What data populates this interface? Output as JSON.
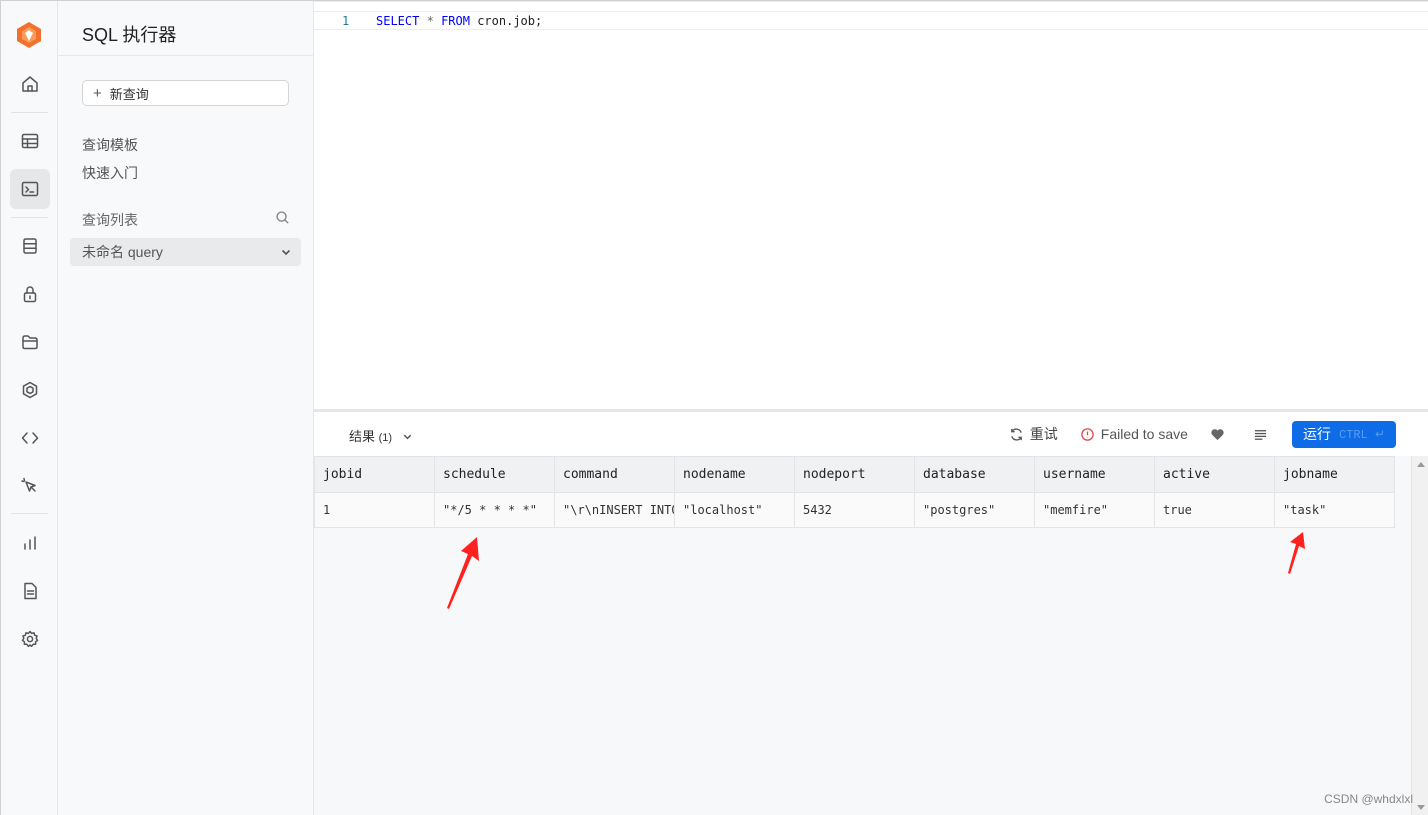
{
  "sidebar": {
    "title": "SQL 执行器",
    "new_query_label": "新查询",
    "links": [
      "查询模板",
      "快速入门"
    ],
    "list_title": "查询列表",
    "query_item": "未命名 query"
  },
  "rail": {
    "icons": [
      "home-icon",
      "table-icon",
      "terminal-icon",
      "database-icon",
      "lock-icon",
      "storage-icon",
      "package-icon",
      "code-icon",
      "pointer-icon",
      "chart-icon",
      "document-icon",
      "settings-icon"
    ],
    "active": "terminal-icon"
  },
  "editor": {
    "line_number": "1",
    "keyword_select": "SELECT",
    "star": "*",
    "keyword_from": "FROM",
    "rest": "cron.job;"
  },
  "toolbar": {
    "results_label": "结果",
    "results_count": "(1)",
    "retry_label": "重试",
    "save_status": "Failed to save",
    "run_label": "运行",
    "run_hint": "CTRL ↵"
  },
  "table": {
    "columns": [
      "jobid",
      "schedule",
      "command",
      "nodename",
      "nodeport",
      "database",
      "username",
      "active",
      "jobname"
    ],
    "rows": [
      [
        "1",
        "\"*/5 * * * *\"",
        "\"\\r\\nINSERT INTO",
        "\"localhost\"",
        "5432",
        "\"postgres\"",
        "\"memfire\"",
        "true",
        "\"task\""
      ]
    ]
  },
  "watermark": "CSDN @whdxlxl",
  "colors": {
    "accent": "#0d6ce6",
    "error": "#e5484d",
    "annotation": "#ff2020",
    "logo": "#f36f2c"
  }
}
